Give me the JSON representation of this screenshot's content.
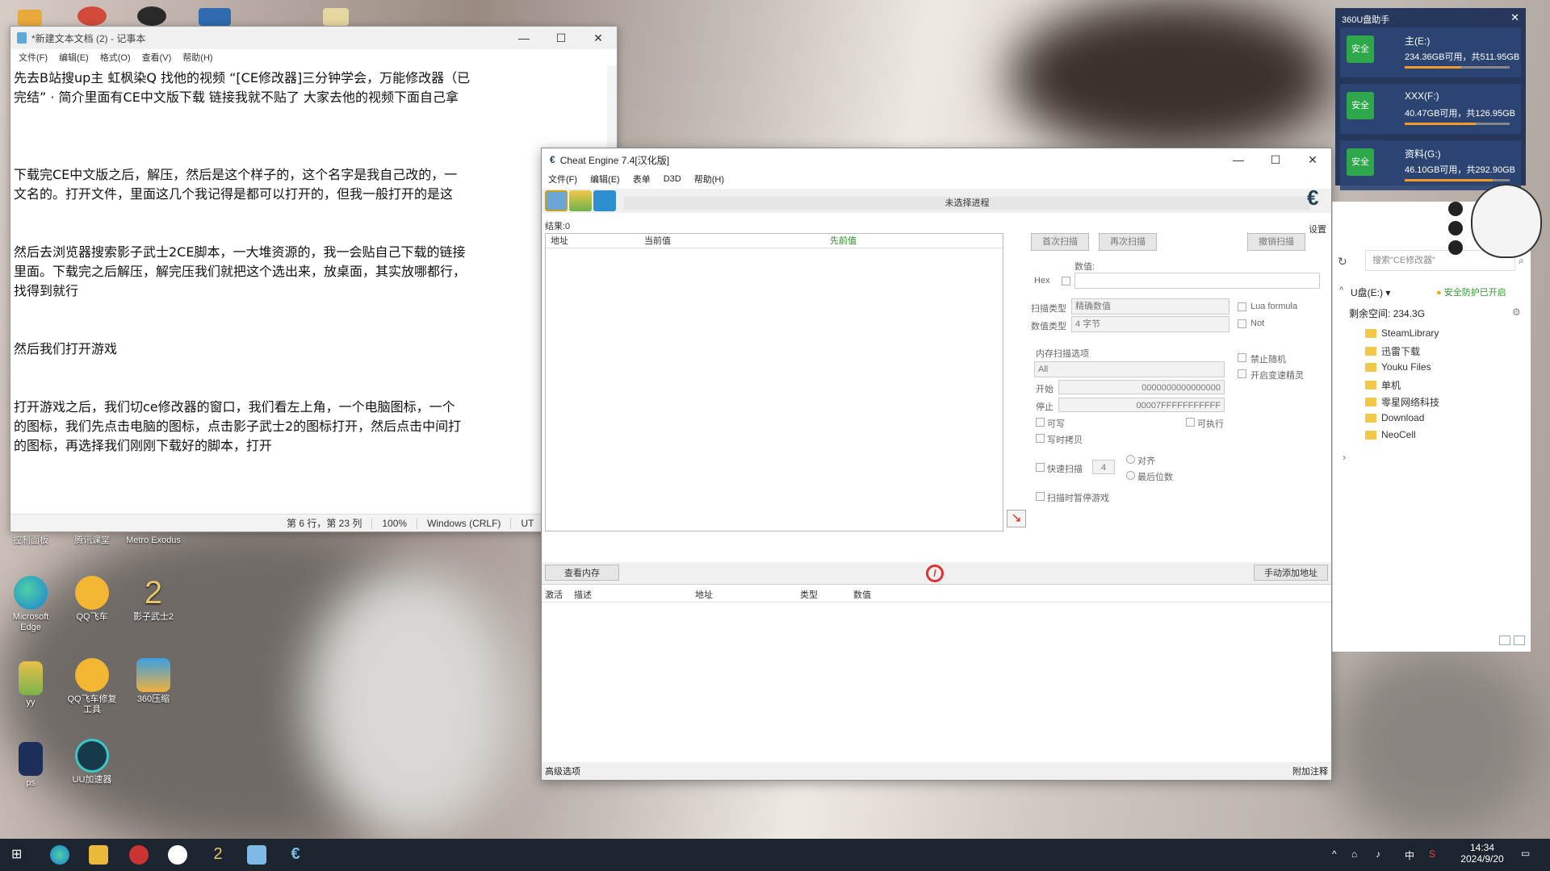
{
  "desktop": {
    "icons": [
      {
        "label": "控制面板"
      },
      {
        "label": "腾讯课堂"
      },
      {
        "label": "Metro Exodus"
      },
      {
        "label": "Microsoft Edge"
      },
      {
        "label": "QQ飞车"
      },
      {
        "label": "影子武士2"
      },
      {
        "label": "yy"
      },
      {
        "label": "QQ飞车修复工具"
      },
      {
        "label": "360压缩"
      },
      {
        "label": "ps"
      },
      {
        "label": "UU加速器"
      }
    ]
  },
  "notepad": {
    "title": "*新建文本文档 (2) - 记事本",
    "menu": [
      "文件(F)",
      "编辑(E)",
      "格式(O)",
      "查看(V)",
      "帮助(H)"
    ],
    "lines": [
      "先去B站搜up主    虹枫染Q      找他的视频 “[CE修改器]三分钟学会，万能修改器（已",
      "完结”   · 简介里面有CE中文版下载   链接我就不贴了   大家去他的视频下面自己拿",
      "",
      "",
      "",
      "下载完CE中文版之后，解压，然后是这个样子的，这个名字是我自己改的，一",
      "文名的。打开文件，里面这几个我记得是都可以打开的，但我一般打开的是这",
      "",
      "",
      "然后去浏览器搜索影子武士2CE脚本，一大堆资源的，我一会贴自己下载的链接",
      "里面。下载完之后解压，解完压我们就把这个选出来，放桌面，其实放哪都行，",
      "找得到就行",
      "",
      "",
      "然后我们打开游戏",
      "",
      "",
      "打开游戏之后，我们切ce修改器的窗口，我们看左上角，一个电脑图标，一个",
      "的图标，我们先点击电脑的图标，点击影子武士2的图标打开，然后点击中间打",
      "的图标，再选择我们刚刚下载好的脚本，打开"
    ],
    "status": {
      "pos": "第 6 行，第 23 列",
      "zoom": "100%",
      "eol": "Windows (CRLF)",
      "enc": "UT"
    }
  },
  "ce": {
    "title": "Cheat Engine 7.4[汉化版]",
    "menu": [
      "文件(F)",
      "编辑(E)",
      "表单",
      "D3D",
      "帮助(H)"
    ],
    "process": "未选择进程",
    "found": "结果:0",
    "list_headers": [
      "地址",
      "当前值",
      "先前值"
    ],
    "first_scan": "首次扫描",
    "next_scan": "再次扫描",
    "undo_scan": "撤销扫描",
    "value_label": "数值:",
    "hex_label": "Hex",
    "scan_type_label": "扫描类型",
    "scan_type": "精确数值",
    "value_type_label": "数值类型",
    "value_type": "4 字节",
    "lua_formula": "Lua formula",
    "not_label": "Not",
    "mem_options": "内存扫描选项",
    "mem_region": "All",
    "start_label": "开始",
    "start_value": "0000000000000000",
    "stop_label": "停止",
    "stop_value": "00007FFFFFFFFFFF",
    "writable": "可写",
    "executable": "可执行",
    "copy_on_write": "写时拷贝",
    "fast_scan": "快速扫描",
    "fast_value": "4",
    "align": "对齐",
    "last_digits": "最后位数",
    "pause_game": "扫描时暂停游戏",
    "no_random": "禁止随机",
    "speedhack": "开启变速精灵",
    "settings": "设置",
    "view_memory": "查看内存",
    "add_address": "手动添加地址",
    "table_headers": [
      "激活",
      "描述",
      "地址",
      "类型",
      "数值"
    ],
    "adv_options": "高级选项",
    "table_extras": "附加注释"
  },
  "widget360": {
    "title": "360U盘助手",
    "drives": [
      {
        "badge": "安全",
        "name": "主(E:)",
        "info": "234.36GB可用，共511.95GB",
        "fill": 0.54
      },
      {
        "badge": "安全",
        "name": "XXX(F:)",
        "info": "40.47GB可用，共126.95GB",
        "fill": 0.68
      },
      {
        "badge": "安全",
        "name": "资料(G:)",
        "info": "46.10GB可用，共292.90GB",
        "fill": 0.84
      }
    ]
  },
  "explorer": {
    "search_placeholder": "搜索\"CE修改器\"",
    "drive": "U盘(E:)",
    "protect": "安全防护已开启",
    "free": "剩余空间: 234.3G",
    "folders": [
      "SteamLibrary",
      "迅雷下载",
      "Youku Files",
      "单机",
      "零星网络科技",
      "Download",
      "NeoCell"
    ]
  },
  "taskbar": {
    "time": "14:34",
    "date": "2024/9/20",
    "ime": "中"
  }
}
